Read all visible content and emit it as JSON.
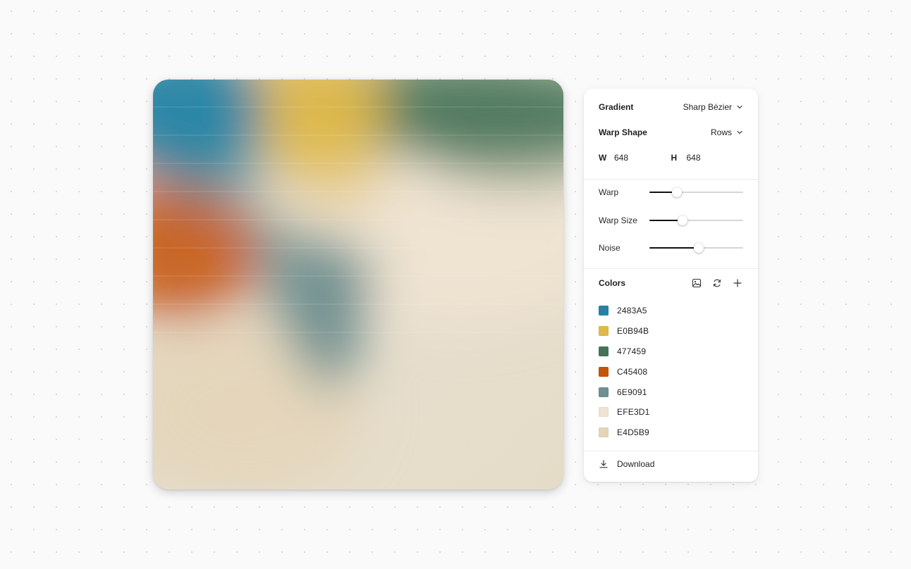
{
  "canvas": {
    "colors": [
      "#2483A5",
      "#E0B94B",
      "#477459",
      "#C45408",
      "#6E9091",
      "#EFE3D1",
      "#E4D5B9"
    ]
  },
  "panel": {
    "gradient": {
      "label": "Gradient",
      "value": "Sharp Bézier"
    },
    "warp_shape": {
      "label": "Warp Shape",
      "value": "Rows"
    },
    "width": {
      "label": "W",
      "value": "648"
    },
    "height": {
      "label": "H",
      "value": "648"
    },
    "sliders": [
      {
        "label": "Warp",
        "value": 0.29
      },
      {
        "label": "Warp Size",
        "value": 0.35
      },
      {
        "label": "Noise",
        "value": 0.53
      }
    ],
    "colors_label": "Colors",
    "icons": {
      "image": "image-icon",
      "refresh": "refresh-icon",
      "add": "plus-icon",
      "download": "download-icon",
      "chevron": "chevron-down-icon"
    },
    "colors": [
      {
        "hex": "2483A5",
        "color": "#2483A5"
      },
      {
        "hex": "E0B94B",
        "color": "#E0B94B"
      },
      {
        "hex": "477459",
        "color": "#477459"
      },
      {
        "hex": "C45408",
        "color": "#C45408"
      },
      {
        "hex": "6E9091",
        "color": "#6E9091"
      },
      {
        "hex": "EFE3D1",
        "color": "#EFE3D1"
      },
      {
        "hex": "E4D5B9",
        "color": "#E4D5B9"
      }
    ],
    "download_label": "Download"
  }
}
